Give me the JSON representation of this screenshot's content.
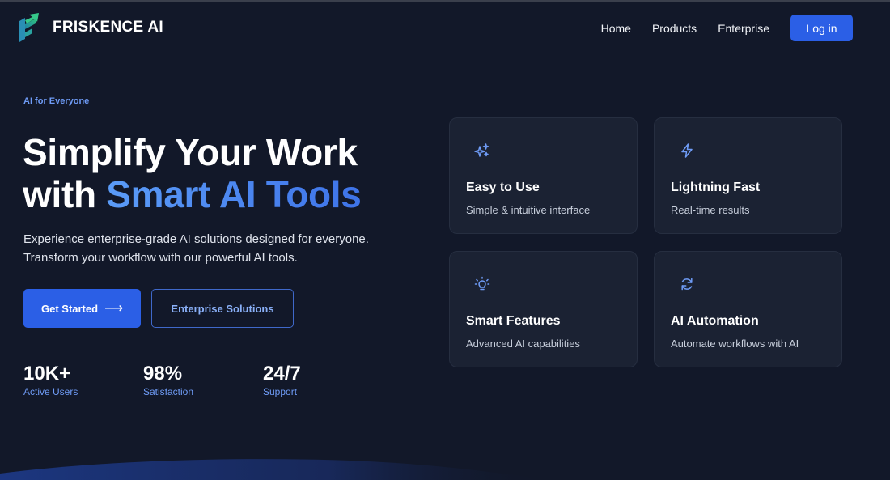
{
  "brand": {
    "name": "FRISKENCE AI",
    "logo_icon": "friskence-logo-icon"
  },
  "nav": {
    "links": [
      "Home",
      "Products",
      "Enterprise"
    ],
    "login_label": "Log in"
  },
  "hero": {
    "tagline": "AI for Everyone",
    "headline_line1": "Simplify Your Work",
    "headline_line2_prefix": "with ",
    "headline_accent": "Smart AI Tools",
    "description_line1": "Experience enterprise-grade AI solutions designed for everyone.",
    "description_line2": "Transform your workflow with our powerful AI tools.",
    "primary_cta": "Get Started",
    "primary_cta_icon": "arrow-right-icon",
    "secondary_cta": "Enterprise Solutions"
  },
  "stats": [
    {
      "value": "10K+",
      "label": "Active Users"
    },
    {
      "value": "98%",
      "label": "Satisfaction"
    },
    {
      "value": "24/7",
      "label": "Support"
    }
  ],
  "features": [
    {
      "icon": "sparkles-icon",
      "title": "Easy to Use",
      "subtitle": "Simple & intuitive interface"
    },
    {
      "icon": "lightning-icon",
      "title": "Lightning Fast",
      "subtitle": "Real-time results"
    },
    {
      "icon": "lightbulb-icon",
      "title": "Smart Features",
      "subtitle": "Advanced AI capabilities"
    },
    {
      "icon": "refresh-icon",
      "title": "AI Automation",
      "subtitle": "Automate workflows with AI"
    }
  ],
  "colors": {
    "background": "#121829",
    "primary": "#2b5fe6",
    "accent_text": "#6f9cf7",
    "card_bg": "#1b2233"
  }
}
